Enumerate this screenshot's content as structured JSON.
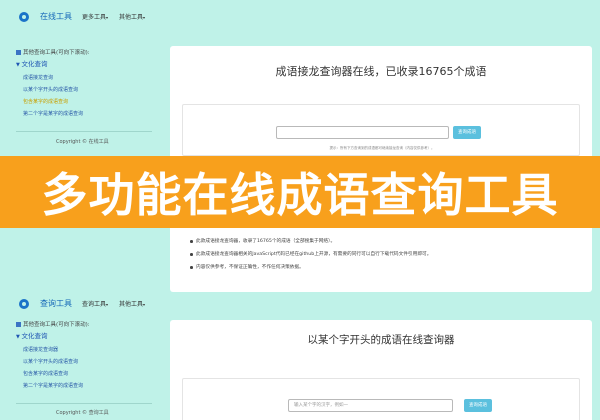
{
  "top": {
    "nav": {
      "brand": "在线工具",
      "menu1": "更多工具",
      "menu2": "其他工具"
    },
    "sidebar": {
      "heading": "其他查询工具(可向下滚动):",
      "category": "文化查询",
      "items": [
        "成语接龙查询",
        "以某个字开头的成语查询",
        "包含某字的成语查询",
        "第二个字是某字的成语查询"
      ],
      "active_index": 2,
      "copyright": "Copyright © 在线工具"
    },
    "main": {
      "title": "成语接龙查询器在线，已收录16765个成语",
      "search_button": "查询成语",
      "hint": "提示：所有下方查询到的成语都可继续接龙查询（内容仅供参考）。",
      "notes": [
        "此款成语接龙查询器，收录了16765个的成语（全部搜集于网络）。",
        "此款成语接龙查询器相关的JavaScript代码已经在github上开源，有需要的同行可以自行下载代码文件引用即可。",
        "内容仅供参考，不保证正确性，不作任何决策依据。"
      ]
    }
  },
  "bottom": {
    "nav": {
      "brand": "查询工具",
      "menu1": "查询工具",
      "menu2": "其他工具"
    },
    "sidebar": {
      "heading": "其他查询工具(可向下滚动):",
      "category": "文化查询",
      "items": [
        "成语接龙查询器",
        "以某个字开头的成语查询",
        "包含某字的成语查询",
        "第二个字是某字的成语查询"
      ],
      "copyright": "Copyright © 查询工具"
    },
    "main": {
      "title": "以某个字开头的成语在线查询器",
      "input_placeholder": "输入某个字的汉字，例如一",
      "search_button": "查询成语"
    }
  },
  "banner": {
    "text": "多功能在线成语查询工具"
  },
  "colors": {
    "page_background": "#bff2e8",
    "brand_blue": "#1769b8",
    "banner_orange": "#f8a01c",
    "button_cyan": "#5bc0de",
    "active_link": "#c8a000"
  },
  "icons": {
    "logo": "logo-circle-icon",
    "sidebar_heading": "grid-tile-icon",
    "dropdown": "caret-down-icon"
  }
}
